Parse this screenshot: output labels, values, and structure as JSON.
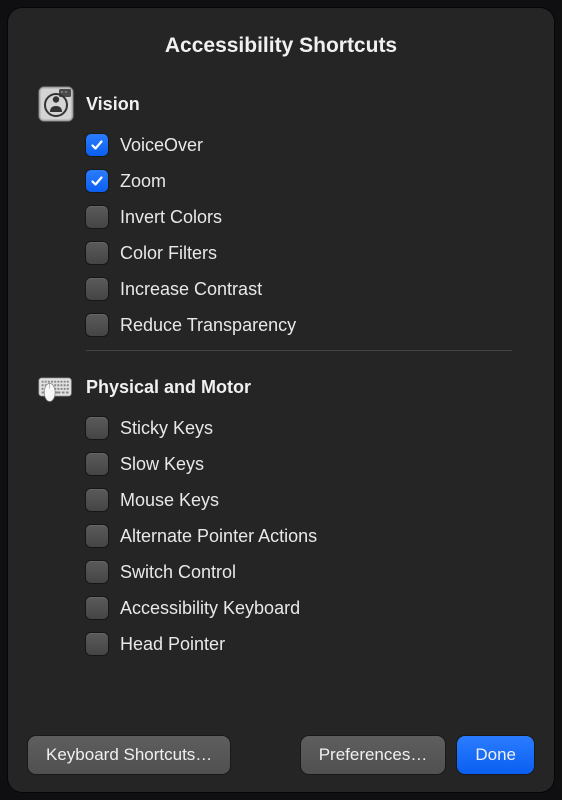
{
  "title": "Accessibility Shortcuts",
  "sections": {
    "vision": {
      "title": "Vision",
      "items": [
        {
          "label": "VoiceOver",
          "checked": true
        },
        {
          "label": "Zoom",
          "checked": true
        },
        {
          "label": "Invert Colors",
          "checked": false
        },
        {
          "label": "Color Filters",
          "checked": false
        },
        {
          "label": "Increase Contrast",
          "checked": false
        },
        {
          "label": "Reduce Transparency",
          "checked": false
        }
      ]
    },
    "physical": {
      "title": "Physical and Motor",
      "items": [
        {
          "label": "Sticky Keys",
          "checked": false
        },
        {
          "label": "Slow Keys",
          "checked": false
        },
        {
          "label": "Mouse Keys",
          "checked": false
        },
        {
          "label": "Alternate Pointer Actions",
          "checked": false
        },
        {
          "label": "Switch Control",
          "checked": false
        },
        {
          "label": "Accessibility Keyboard",
          "checked": false
        },
        {
          "label": "Head Pointer",
          "checked": false
        }
      ]
    }
  },
  "buttons": {
    "keyboard_shortcuts": "Keyboard Shortcuts…",
    "preferences": "Preferences…",
    "done": "Done"
  }
}
